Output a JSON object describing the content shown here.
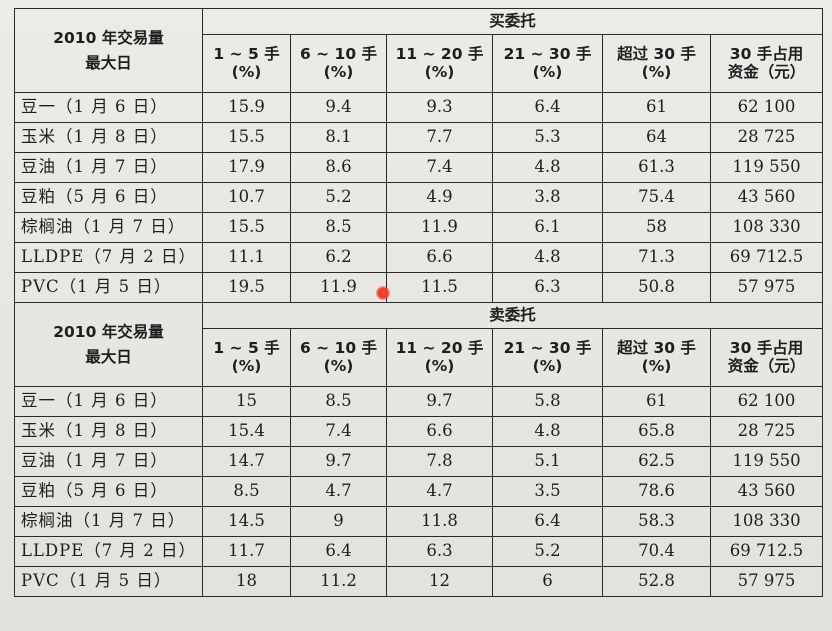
{
  "corner_label_line1": "2010 年交易量",
  "corner_label_line2": "最大日",
  "buy": {
    "title": "买委托",
    "columns": [
      {
        "line1": "1 ~ 5 手",
        "line2": "(%)"
      },
      {
        "line1": "6 ~ 10 手",
        "line2": "(%)"
      },
      {
        "line1": "11 ~ 20 手",
        "line2": "(%)"
      },
      {
        "line1": "21 ~ 30 手",
        "line2": "(%)"
      },
      {
        "line1": "超过 30 手",
        "line2": "(%)"
      },
      {
        "line1": "30 手占用",
        "line2": "资金（元）"
      }
    ],
    "rows": [
      {
        "label": "豆一（1 月 6 日）",
        "values": [
          "15.9",
          "9.4",
          "9.3",
          "6.4",
          "61",
          "62 100"
        ]
      },
      {
        "label": "玉米（1 月 8 日）",
        "values": [
          "15.5",
          "8.1",
          "7.7",
          "5.3",
          "64",
          "28 725"
        ]
      },
      {
        "label": "豆油（1 月 7 日）",
        "values": [
          "17.9",
          "8.6",
          "7.4",
          "4.8",
          "61.3",
          "119 550"
        ]
      },
      {
        "label": "豆粕（5 月 6 日）",
        "values": [
          "10.7",
          "5.2",
          "4.9",
          "3.8",
          "75.4",
          "43 560"
        ]
      },
      {
        "label": "棕榈油（1 月 7 日）",
        "values": [
          "15.5",
          "8.5",
          "11.9",
          "6.1",
          "58",
          "108 330"
        ]
      },
      {
        "label": "LLDPE（7 月 2 日）",
        "values": [
          "11.1",
          "6.2",
          "6.6",
          "4.8",
          "71.3",
          "69 712.5"
        ]
      },
      {
        "label": "PVC（1 月 5 日）",
        "values": [
          "19.5",
          "11.9",
          "11.5",
          "6.3",
          "50.8",
          "57 975"
        ]
      }
    ]
  },
  "sell": {
    "title": "卖委托",
    "columns": [
      {
        "line1": "1 ~ 5 手",
        "line2": "(%)"
      },
      {
        "line1": "6 ~ 10 手",
        "line2": "(%)"
      },
      {
        "line1": "11 ~ 20 手",
        "line2": "(%)"
      },
      {
        "line1": "21 ~ 30 手",
        "line2": "(%)"
      },
      {
        "line1": "超过 30 手",
        "line2": "(%)"
      },
      {
        "line1": "30 手占用",
        "line2": "资金（元）"
      }
    ],
    "rows": [
      {
        "label": "豆一（1 月 6 日）",
        "values": [
          "15",
          "8.5",
          "9.7",
          "5.8",
          "61",
          "62 100"
        ]
      },
      {
        "label": "玉米（1 月 8 日）",
        "values": [
          "15.4",
          "7.4",
          "6.6",
          "4.8",
          "65.8",
          "28 725"
        ]
      },
      {
        "label": "豆油（1 月 7 日）",
        "values": [
          "14.7",
          "9.7",
          "7.8",
          "5.1",
          "62.5",
          "119 550"
        ]
      },
      {
        "label": "豆粕（5 月 6 日）",
        "values": [
          "8.5",
          "4.7",
          "4.7",
          "3.5",
          "78.6",
          "43 560"
        ]
      },
      {
        "label": "棕榈油（1 月 7 日）",
        "values": [
          "14.5",
          "9",
          "11.8",
          "6.4",
          "58.3",
          "108 330"
        ]
      },
      {
        "label": "LLDPE（7 月 2 日）",
        "values": [
          "11.7",
          "6.4",
          "6.3",
          "5.2",
          "70.4",
          "69 712.5"
        ]
      },
      {
        "label": "PVC（1 月 5 日）",
        "values": [
          "18",
          "11.2",
          "12",
          "6",
          "52.8",
          "57 975"
        ]
      }
    ]
  }
}
